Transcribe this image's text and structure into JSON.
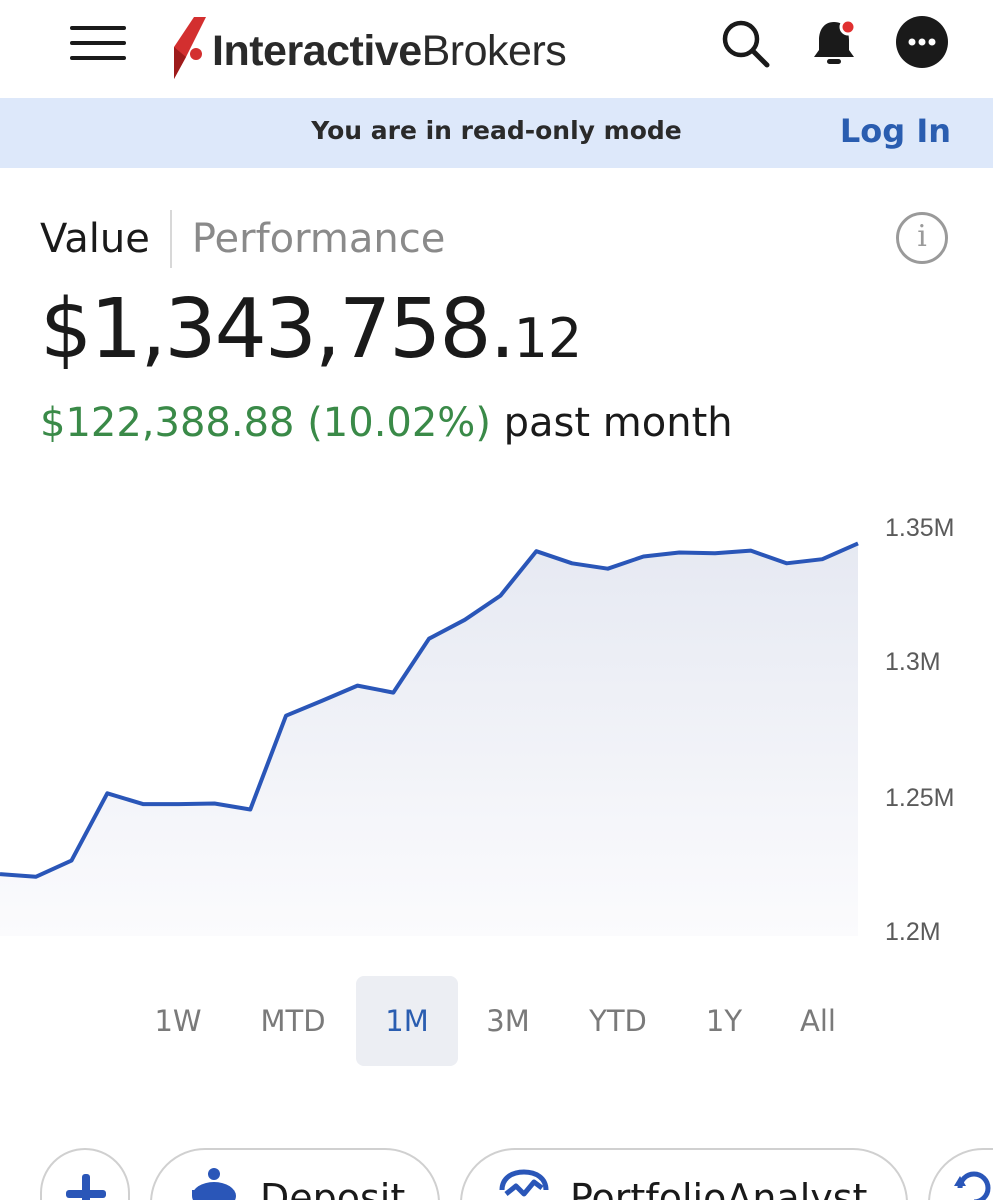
{
  "header": {
    "logo_text_bold": "Interactive",
    "logo_text_regular": "Brokers",
    "brand_color": "#d32f2f",
    "icons": [
      "menu-icon",
      "search-icon",
      "bell-icon",
      "more-icon"
    ]
  },
  "banner": {
    "text": "You are in read-only mode",
    "login_label": "Log In"
  },
  "toggle": {
    "value_label": "Value",
    "performance_label": "Performance"
  },
  "portfolio": {
    "value_main": "$1,343,758.",
    "value_cents": "12",
    "change_amount": "$122,388.88 (10.02%)",
    "change_period": "past month",
    "positive_color": "#3a8a48"
  },
  "chart_data": {
    "type": "area",
    "y_tick_labels": [
      "1.35M",
      "1.3M",
      "1.25M",
      "1.2M"
    ],
    "ylim": [
      1.2,
      1.35
    ],
    "y_unit": "M",
    "line_color": "#2a56b8",
    "grid": false,
    "values": [
      1.2215,
      1.2205,
      1.2265,
      1.2515,
      1.2475,
      1.2475,
      1.2477,
      1.2455,
      1.2803,
      1.2858,
      1.2915,
      1.2889,
      1.3089,
      1.3159,
      1.3249,
      1.3414,
      1.3369,
      1.3349,
      1.3394,
      1.3409,
      1.3406,
      1.3416,
      1.3369,
      1.3384,
      1.3443
    ]
  },
  "ranges": {
    "items": [
      "1W",
      "MTD",
      "1M",
      "3M",
      "YTD",
      "1Y",
      "All"
    ],
    "selected": "1M"
  },
  "actions": {
    "add_icon": "plus-icon",
    "deposit_label": "Deposit",
    "deposit_icon": "piggy-bank-icon",
    "portfolio_label": "PortfolioAnalyst",
    "portfolio_icon": "analytics-icon",
    "next_icon": "refresh-icon"
  }
}
